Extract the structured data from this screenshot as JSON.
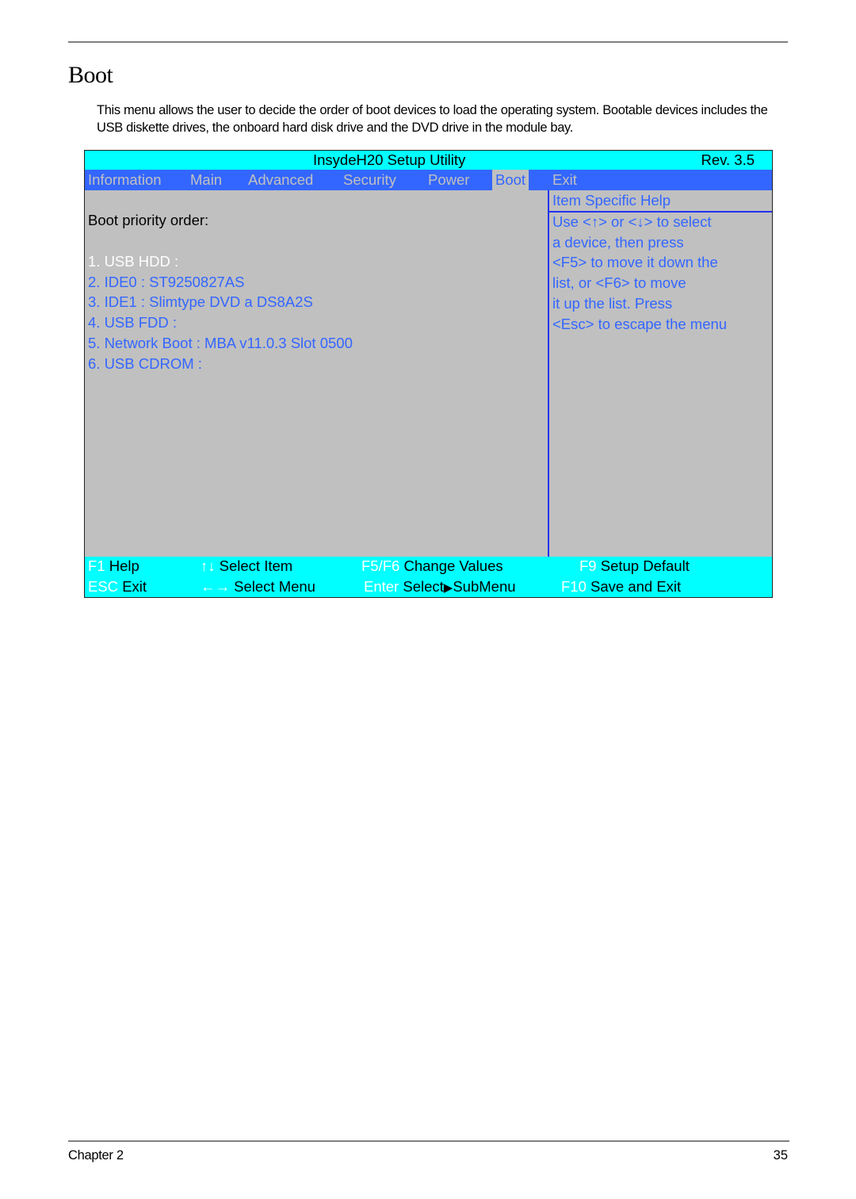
{
  "document": {
    "title": "Boot",
    "intro": "This menu allows the user to decide the order of boot devices to load the operating system. Bootable devices includes the USB diskette drives, the onboard hard disk drive and the DVD drive in the module bay.",
    "footer_left": "Chapter 2",
    "footer_right": "35"
  },
  "bios": {
    "title": "InsydeH20 Setup Utility",
    "revision": "Rev. 3.5",
    "colors": {
      "title_bar": "#00ffff",
      "tab_bar": "#3366ff",
      "panel": "#c0c0c0",
      "item_text": "#3366ff",
      "selected_text": "#ffffff"
    },
    "tabs": [
      {
        "label": "Information",
        "active": false
      },
      {
        "label": "Main",
        "active": false
      },
      {
        "label": "Advanced",
        "active": false
      },
      {
        "label": "Security",
        "active": false
      },
      {
        "label": "Power",
        "active": false
      },
      {
        "label": "Boot",
        "active": true
      },
      {
        "label": "Exit",
        "active": false
      }
    ],
    "section_label": "Boot priority order:",
    "boot_items": [
      {
        "label": "1. USB HDD :",
        "selected": true
      },
      {
        "label": "2. IDE0 : ST9250827AS",
        "selected": false
      },
      {
        "label": "3. IDE1 : Slimtype DVD a DS8A2S",
        "selected": false
      },
      {
        "label": "4. USB FDD :",
        "selected": false
      },
      {
        "label": "5. Network Boot : MBA v11.0.3 Slot 0500",
        "selected": false
      },
      {
        "label": "6. USB CDROM :",
        "selected": false
      }
    ],
    "help": {
      "heading": "Item Specific Help",
      "lines": [
        "Use <↑> or <↓> to select",
        "a device, then press",
        "<F5> to move it down the",
        "list, or <F6> to move",
        "it up the list. Press",
        "<Esc> to escape the menu"
      ]
    },
    "footer_keys": [
      {
        "key": "F1",
        "action": "Help"
      },
      {
        "key": "↑↓",
        "action": "Select Item"
      },
      {
        "key": "F5/F6",
        "action": "Change Values"
      },
      {
        "key": "F9",
        "action": "Setup Default"
      },
      {
        "key": "ESC",
        "action": "Exit"
      },
      {
        "key": "←→",
        "action": "Select Menu"
      },
      {
        "key": "Enter",
        "action": "Select",
        "icon": "▶",
        "action2": "SubMenu"
      },
      {
        "key": "F10",
        "action": "Save and Exit"
      }
    ]
  }
}
